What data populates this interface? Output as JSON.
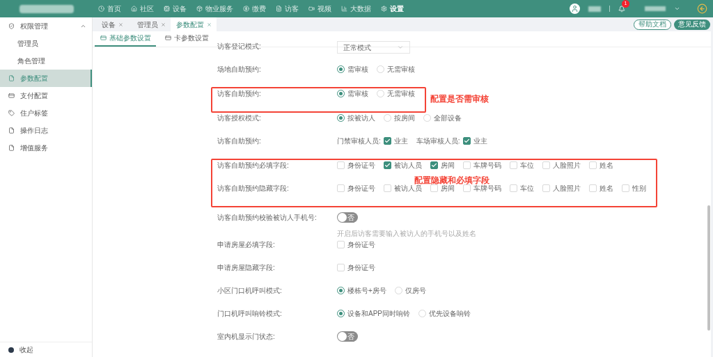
{
  "top_nav": {
    "items": [
      {
        "label": "首页",
        "selected": false
      },
      {
        "label": "社区",
        "selected": false
      },
      {
        "label": "设备",
        "selected": false
      },
      {
        "label": "物业服务",
        "selected": false
      },
      {
        "label": "缴费",
        "selected": false
      },
      {
        "label": "访客",
        "selected": false
      },
      {
        "label": "视频",
        "selected": false
      },
      {
        "label": "大数据",
        "selected": false
      },
      {
        "label": "设置",
        "selected": true
      }
    ],
    "notification_count": "1"
  },
  "sidebar": {
    "items": [
      {
        "label": "权限管理",
        "expanded": true,
        "selected": false,
        "children": [
          {
            "label": "管理员",
            "selected": false
          },
          {
            "label": "角色管理",
            "selected": false
          }
        ]
      },
      {
        "label": "参数配置",
        "selected": true
      },
      {
        "label": "支付配置",
        "selected": false
      },
      {
        "label": "住户标签",
        "selected": false
      },
      {
        "label": "操作日志",
        "selected": false
      },
      {
        "label": "增值服务",
        "selected": false
      }
    ],
    "collapse_label": "收起"
  },
  "tabs": [
    {
      "label": "设备",
      "selected": false
    },
    {
      "label": "管理员",
      "selected": false
    },
    {
      "label": "参数配置",
      "selected": true
    }
  ],
  "header_buttons": [
    {
      "label": "帮助文档",
      "kind": "outline"
    },
    {
      "label": "意见反馈",
      "kind": "filled"
    }
  ],
  "sub_tabs": [
    {
      "label": "基础参数设置",
      "selected": true
    },
    {
      "label": "卡参数设置",
      "selected": false
    }
  ],
  "groups": [
    {
      "outlined": false,
      "rows": [
        {
          "label": "访客登记模式:",
          "kind": "select",
          "value": "正常模式"
        },
        {
          "label": "场地自助预约:",
          "kind": "radio",
          "options": [
            {
              "label": "需审核",
              "selected": true
            },
            {
              "label": "无需审核",
              "selected": false
            }
          ]
        }
      ]
    },
    {
      "outlined": true,
      "note": "配置是否需审核",
      "rows": [
        {
          "label": "访客自助预约:",
          "kind": "radio",
          "options": [
            {
              "label": "需审核",
              "selected": true
            },
            {
              "label": "无需审核",
              "selected": false
            }
          ]
        }
      ]
    },
    {
      "outlined": false,
      "rows": [
        {
          "label": "访客授权模式:",
          "kind": "radio",
          "options": [
            {
              "label": "按被访人",
              "selected": true
            },
            {
              "label": "按房间",
              "selected": false
            },
            {
              "label": "全部设备",
              "selected": false
            }
          ]
        },
        {
          "label": "访客自助预约:",
          "kind": "reviewers",
          "options": [
            {
              "prefix": "门禁审核人员:",
              "label": "业主",
              "checked": true
            },
            {
              "prefix": "车场审核人员:",
              "label": "业主",
              "checked": true
            }
          ]
        }
      ]
    },
    {
      "outlined": true,
      "note": "配置隐藏和必填字段",
      "rows": [
        {
          "label": "访客自助预约必填字段:",
          "kind": "checkbox",
          "options": [
            {
              "label": "身份证号",
              "checked": false
            },
            {
              "label": "被访人员",
              "checked": true
            },
            {
              "label": "房间",
              "checked": true
            },
            {
              "label": "车牌号码",
              "checked": false
            },
            {
              "label": "车位",
              "checked": false
            },
            {
              "label": "人脸照片",
              "checked": false
            },
            {
              "label": "姓名",
              "checked": false
            }
          ]
        },
        {
          "label": "访客自助预约隐藏字段:",
          "kind": "checkbox",
          "options": [
            {
              "label": "身份证号",
              "checked": false
            },
            {
              "label": "被访人员",
              "checked": false
            },
            {
              "label": "房间",
              "checked": false
            },
            {
              "label": "车牌号码",
              "checked": false
            },
            {
              "label": "车位",
              "checked": false
            },
            {
              "label": "人脸照片",
              "checked": false
            },
            {
              "label": "姓名",
              "checked": false
            },
            {
              "label": "性别",
              "checked": false
            }
          ]
        }
      ]
    },
    {
      "outlined": false,
      "rows": [
        {
          "label": "访客自助预约校验被访人手机号:",
          "kind": "switch",
          "on": false,
          "switch_text": "否",
          "hint": "开启后访客需要输入被访人的手机号以及姓名"
        },
        {
          "label": "申请房屋必填字段:",
          "kind": "checkbox",
          "options": [
            {
              "label": "身份证号",
              "checked": false
            }
          ]
        },
        {
          "label": "申请房屋隐藏字段:",
          "kind": "checkbox",
          "options": [
            {
              "label": "身份证号",
              "checked": false
            }
          ]
        },
        {
          "label": "小区门口机呼叫模式:",
          "kind": "radio",
          "options": [
            {
              "label": "楼栋号+房号",
              "selected": true
            },
            {
              "label": "仅房号",
              "selected": false
            }
          ]
        },
        {
          "label": "门口机呼叫响铃模式:",
          "kind": "radio",
          "options": [
            {
              "label": "设备和APP同时响铃",
              "selected": true
            },
            {
              "label": "优先设备响铃",
              "selected": false
            }
          ]
        },
        {
          "label": "室内机显示门状态:",
          "kind": "switch",
          "on": false,
          "switch_text": "否"
        }
      ]
    }
  ]
}
